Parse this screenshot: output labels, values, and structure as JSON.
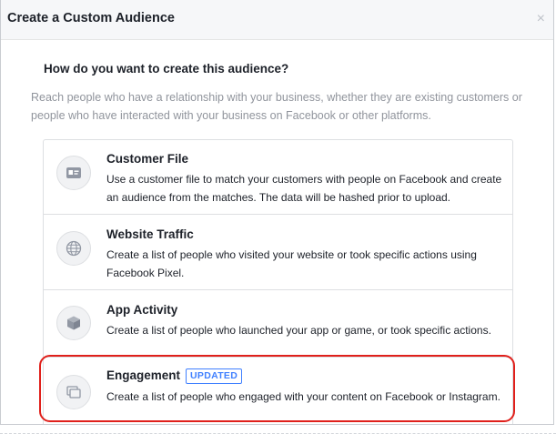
{
  "dialog": {
    "title": "Create a Custom Audience",
    "close_icon": "close-icon",
    "close_glyph": "×"
  },
  "main": {
    "question": "How do you want to create this audience?",
    "description": "Reach people who have a relationship with your business, whether they are existing customers or people who have interacted with your business on Facebook or other platforms."
  },
  "options": [
    {
      "title": "Customer File",
      "description": "Use a customer file to match your customers with people on Facebook and create an audience from the matches. The data will be hashed prior to upload.",
      "icon": "contact-card-icon"
    },
    {
      "title": "Website Traffic",
      "description": "Create a list of people who visited your website or took specific actions using Facebook Pixel.",
      "icon": "globe-icon"
    },
    {
      "title": "App Activity",
      "description": "Create a list of people who launched your app or game, or took specific actions.",
      "icon": "cube-icon"
    },
    {
      "title": "Engagement",
      "badge": "UPDATED",
      "description": "Create a list of people who engaged with your content on Facebook or Instagram.",
      "icon": "stacked-pages-icon"
    }
  ],
  "colors": {
    "highlight": "#e0201b",
    "badge": "#4080ff",
    "muted_text": "#90949c"
  }
}
